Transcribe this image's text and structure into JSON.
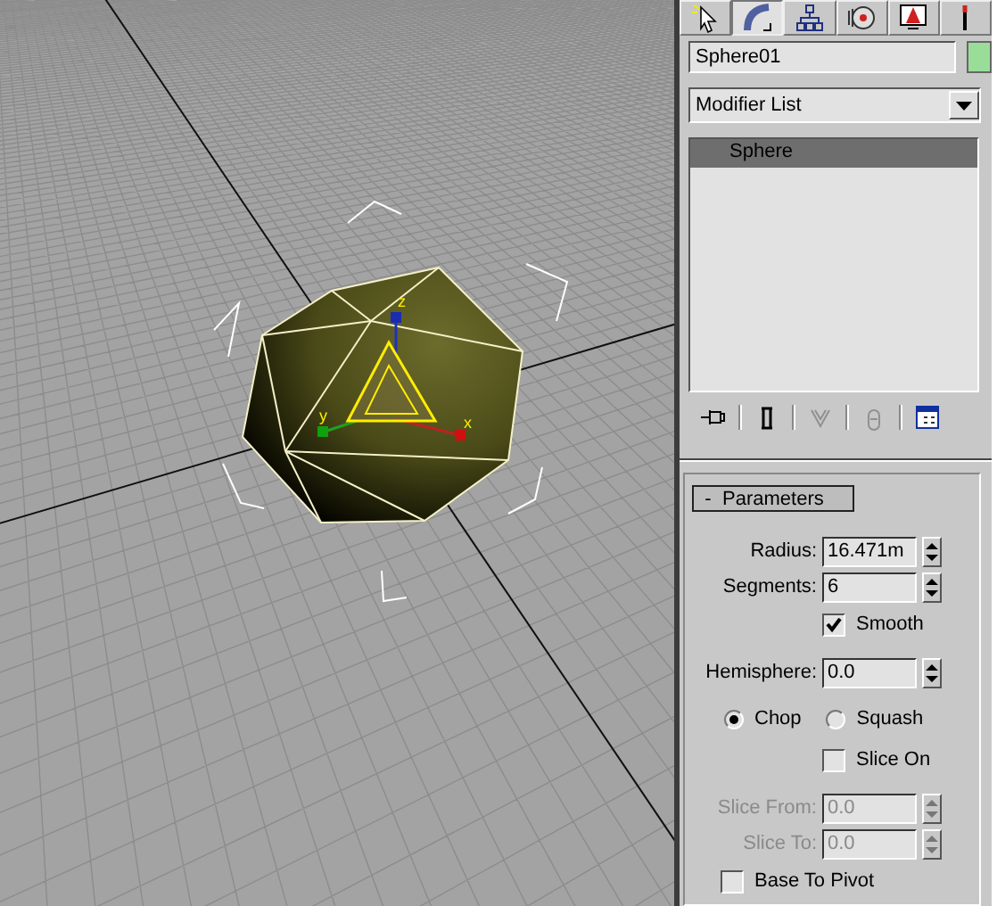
{
  "viewport": {
    "axis_labels": [
      "z",
      "y",
      "x"
    ]
  },
  "command_panel": {
    "tabs": [
      {
        "kind": "create",
        "selected": false
      },
      {
        "kind": "modify",
        "selected": true
      },
      {
        "kind": "hierarchy",
        "selected": false
      },
      {
        "kind": "motion",
        "selected": false
      },
      {
        "kind": "display",
        "selected": false
      },
      {
        "kind": "utilities",
        "selected": false
      }
    ],
    "object": {
      "name": "Sphere01",
      "color": "#99dd99"
    },
    "modifier_list": {
      "value": "Modifier List"
    },
    "stack": [
      {
        "label": "Sphere",
        "selected": true
      }
    ],
    "stack_tools": [
      {
        "kind": "pin",
        "disabled": false
      },
      {
        "kind": "show-end",
        "disabled": false
      },
      {
        "kind": "make-unique",
        "disabled": true
      },
      {
        "kind": "remove",
        "disabled": true
      },
      {
        "kind": "configure",
        "disabled": false
      }
    ],
    "rollout": {
      "toggle": "-",
      "title": "Parameters",
      "parameters": [
        {
          "kind": "spinner",
          "label": "Radius:",
          "value": "16.471m",
          "disabled": false
        },
        {
          "kind": "spinner",
          "label": "Segments:",
          "value": "6",
          "disabled": false
        },
        {
          "kind": "checkbox",
          "label": "Smooth",
          "checked": true
        },
        {
          "kind": "spinner",
          "label": "Hemisphere:",
          "value": "0.0",
          "disabled": false
        },
        {
          "kind": "radios",
          "options": [
            {
              "label": "Chop",
              "selected": true
            },
            {
              "label": "Squash",
              "selected": false
            }
          ]
        },
        {
          "kind": "checkbox",
          "label": "Slice On",
          "checked": false
        },
        {
          "kind": "spinner",
          "label": "Slice From:",
          "value": "0.0",
          "disabled": true
        },
        {
          "kind": "spinner",
          "label": "Slice To:",
          "value": "0.0",
          "disabled": true
        },
        {
          "kind": "left-checkbox",
          "label": "Base To Pivot",
          "checked": false
        }
      ]
    }
  }
}
